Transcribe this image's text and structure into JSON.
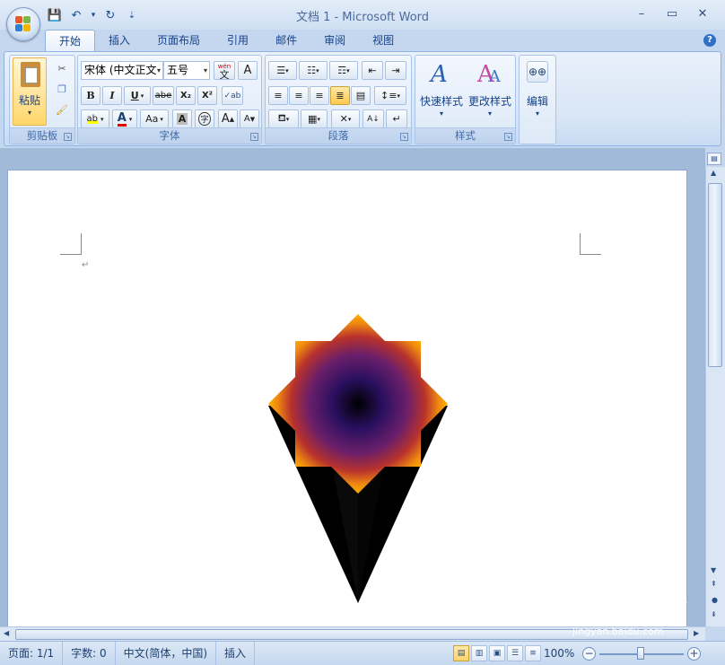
{
  "window": {
    "title": "文档 1 - Microsoft Word",
    "minimize": "–",
    "maximize": "▭",
    "close": "✕"
  },
  "qat": {
    "save": "💾",
    "undo": "↶",
    "dropdown": "▾",
    "redo": "↻",
    "customize": "⇣"
  },
  "tabs": [
    "开始",
    "插入",
    "页面布局",
    "引用",
    "邮件",
    "审阅",
    "视图"
  ],
  "ribbon": {
    "clipboard": {
      "label": "剪贴板",
      "paste": "粘贴"
    },
    "font": {
      "label": "字体",
      "font_name": "宋体 (中文正文",
      "font_size": "五号",
      "wen": "wén",
      "wen_char": "文",
      "A": "A",
      "bold": "B",
      "italic": "I",
      "underline": "U",
      "strike": "abe",
      "sub": "X₂",
      "sup": "X²",
      "highlight": "ab",
      "color": "A",
      "case": "Aa",
      "shade": "A",
      "char_border": "字",
      "grow": "A",
      "shrink": "A"
    },
    "paragraph": {
      "label": "段落"
    },
    "styles": {
      "label": "样式",
      "quick": "快速样式",
      "change": "更改样式"
    },
    "editing": {
      "label": "编辑"
    }
  },
  "doc": {
    "paragraph_mark": "↵"
  },
  "status": {
    "page": "页面: 1/1",
    "words": "字数: 0",
    "language": "中文(简体，中国)",
    "insert": "插入",
    "zoom": "100%"
  },
  "watermark": {
    "brand": "Baidu经验",
    "url": "jingyan.baidu.com"
  },
  "colors": {
    "accent": "#15428b",
    "ribbon": "#dde9f8",
    "page": "#ffffff"
  }
}
